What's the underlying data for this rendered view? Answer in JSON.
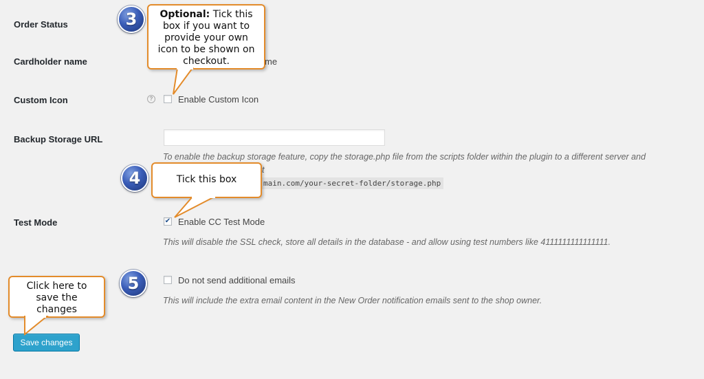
{
  "fields": {
    "order_status_label": "Order Status",
    "cardholder_label": "Cardholder name",
    "cardholder_partial_value": "me",
    "custom_icon_label": "Custom Icon",
    "custom_icon_checkbox_label": "Enable Custom Icon",
    "backup_url_label": "Backup Storage URL",
    "backup_url_value": "",
    "backup_url_desc_line1": "To enable the backup storage feature, copy the storage.php file from the scripts folder within the plugin to a different server and",
    "backup_url_desc_line2_partial": "t",
    "backup_url_code": "main.com/your-secret-folder/storage.php",
    "test_mode_label": "Test Mode",
    "test_mode_checkbox_label": "Enable CC Test Mode",
    "test_mode_desc": "This will disable the SSL check, store all details in the database - and allow using test numbers like 4111111111111111.",
    "emails_checkbox_label": "Do not send additional emails",
    "emails_desc": "This will include the extra email content in the New Order notification emails sent to the shop owner."
  },
  "state": {
    "custom_icon_checked": false,
    "test_mode_checked": true,
    "emails_checked": false
  },
  "help_icon_glyph": "?",
  "save_button_label": "Save changes",
  "annotations": {
    "badge_3": "3",
    "badge_4": "4",
    "badge_5": "5",
    "callout_3_bold": "Optional:",
    "callout_3_text_1": " Tick this",
    "callout_3_text_2": "box if you want to",
    "callout_3_text_3": "provide your own",
    "callout_3_text_4": "icon to be shown on",
    "callout_3_text_5": "checkout.",
    "callout_4_text": "Tick this box",
    "callout_5_text_1": "Click here to",
    "callout_5_text_2": "save the",
    "callout_5_text_3": "changes"
  },
  "colors": {
    "background": "#f1f1f1",
    "callout_border": "#e38b2a",
    "button_primary": "#2ea2cc",
    "badge_blue": "#3a5db8"
  }
}
